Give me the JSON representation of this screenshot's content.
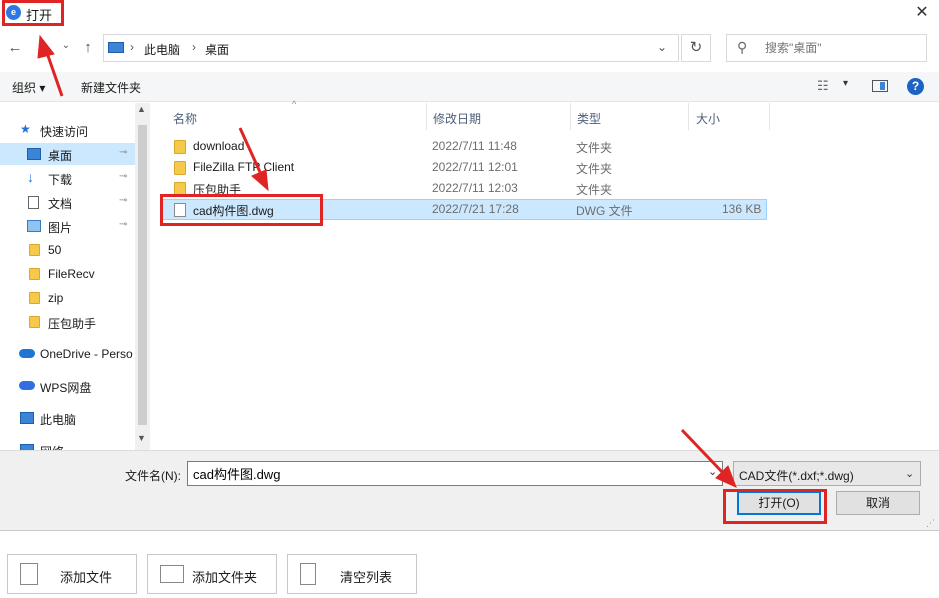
{
  "window": {
    "title": "打开",
    "close_glyph": "✕"
  },
  "nav": {
    "back_glyph": "←",
    "forward_glyph": "→",
    "history_glyph": "⌄",
    "up_glyph": "↑"
  },
  "address": {
    "sep": "›",
    "segments": [
      "此电脑",
      "桌面"
    ],
    "dropdown_glyph": "⌄",
    "refresh_glyph": "↻"
  },
  "search": {
    "placeholder": "搜索\"桌面\"",
    "icon_glyph": "⚲"
  },
  "toolbar": {
    "organize_label": "组织 ▾",
    "new_folder_label": "新建文件夹",
    "view_glyph": "☷",
    "view_chev": "▾",
    "help_glyph": "?"
  },
  "sidebar": {
    "up": "▲",
    "down": "▼",
    "pin": "📌",
    "items": [
      {
        "label": "快速访问",
        "icon": "star-icon"
      },
      {
        "label": "桌面",
        "icon": "desktop-icon",
        "selected": true,
        "pinned": true
      },
      {
        "label": "下载",
        "icon": "download-icon",
        "pinned": true
      },
      {
        "label": "文档",
        "icon": "document-icon",
        "pinned": true
      },
      {
        "label": "图片",
        "icon": "picture-icon",
        "pinned": true
      },
      {
        "label": "50",
        "icon": "folder-icon"
      },
      {
        "label": "FileRecv",
        "icon": "folder-icon"
      },
      {
        "label": "zip",
        "icon": "folder-icon"
      },
      {
        "label": "压包助手",
        "icon": "folder-icon"
      },
      {
        "label": "OneDrive - Perso",
        "icon": "onedrive-icon"
      },
      {
        "label": "WPS网盘",
        "icon": "wps-cloud-icon"
      },
      {
        "label": "此电脑",
        "icon": "pc-icon"
      },
      {
        "label": "网络",
        "icon": "network-icon"
      }
    ]
  },
  "columns": {
    "name": "名称",
    "date": "修改日期",
    "type": "类型",
    "size": "大小",
    "sort_glyph": "^"
  },
  "files": [
    {
      "name": "download",
      "date": "2022/7/11 11:48",
      "type": "文件夹",
      "size": "",
      "icon": "folder-icon"
    },
    {
      "name": "FileZilla FTP Client",
      "date": "2022/7/11 12:01",
      "type": "文件夹",
      "size": "",
      "icon": "folder-icon"
    },
    {
      "name": "压包助手",
      "date": "2022/7/11 12:03",
      "type": "文件夹",
      "size": "",
      "icon": "folder-icon"
    },
    {
      "name": "cad构件图.dwg",
      "date": "2022/7/21 17:28",
      "type": "DWG 文件",
      "size": "136 KB",
      "icon": "file-icon",
      "selected": true
    }
  ],
  "bottom": {
    "filename_label": "文件名(N):",
    "filename_value": "cad构件图.dwg",
    "filename_chev": "⌄",
    "filter_label": "CAD文件(*.dxf;*.dwg)",
    "filter_chev": "⌄",
    "open_label": "打开(O)",
    "cancel_label": "取消",
    "grip": "⋰"
  },
  "app_buttons": {
    "add_file": "添加文件",
    "add_folder": "添加文件夹",
    "clear_list": "清空列表"
  },
  "colors": {
    "annotation_red": "#e02424",
    "selection_blue": "#cce8ff",
    "accent_blue": "#0078d7"
  }
}
